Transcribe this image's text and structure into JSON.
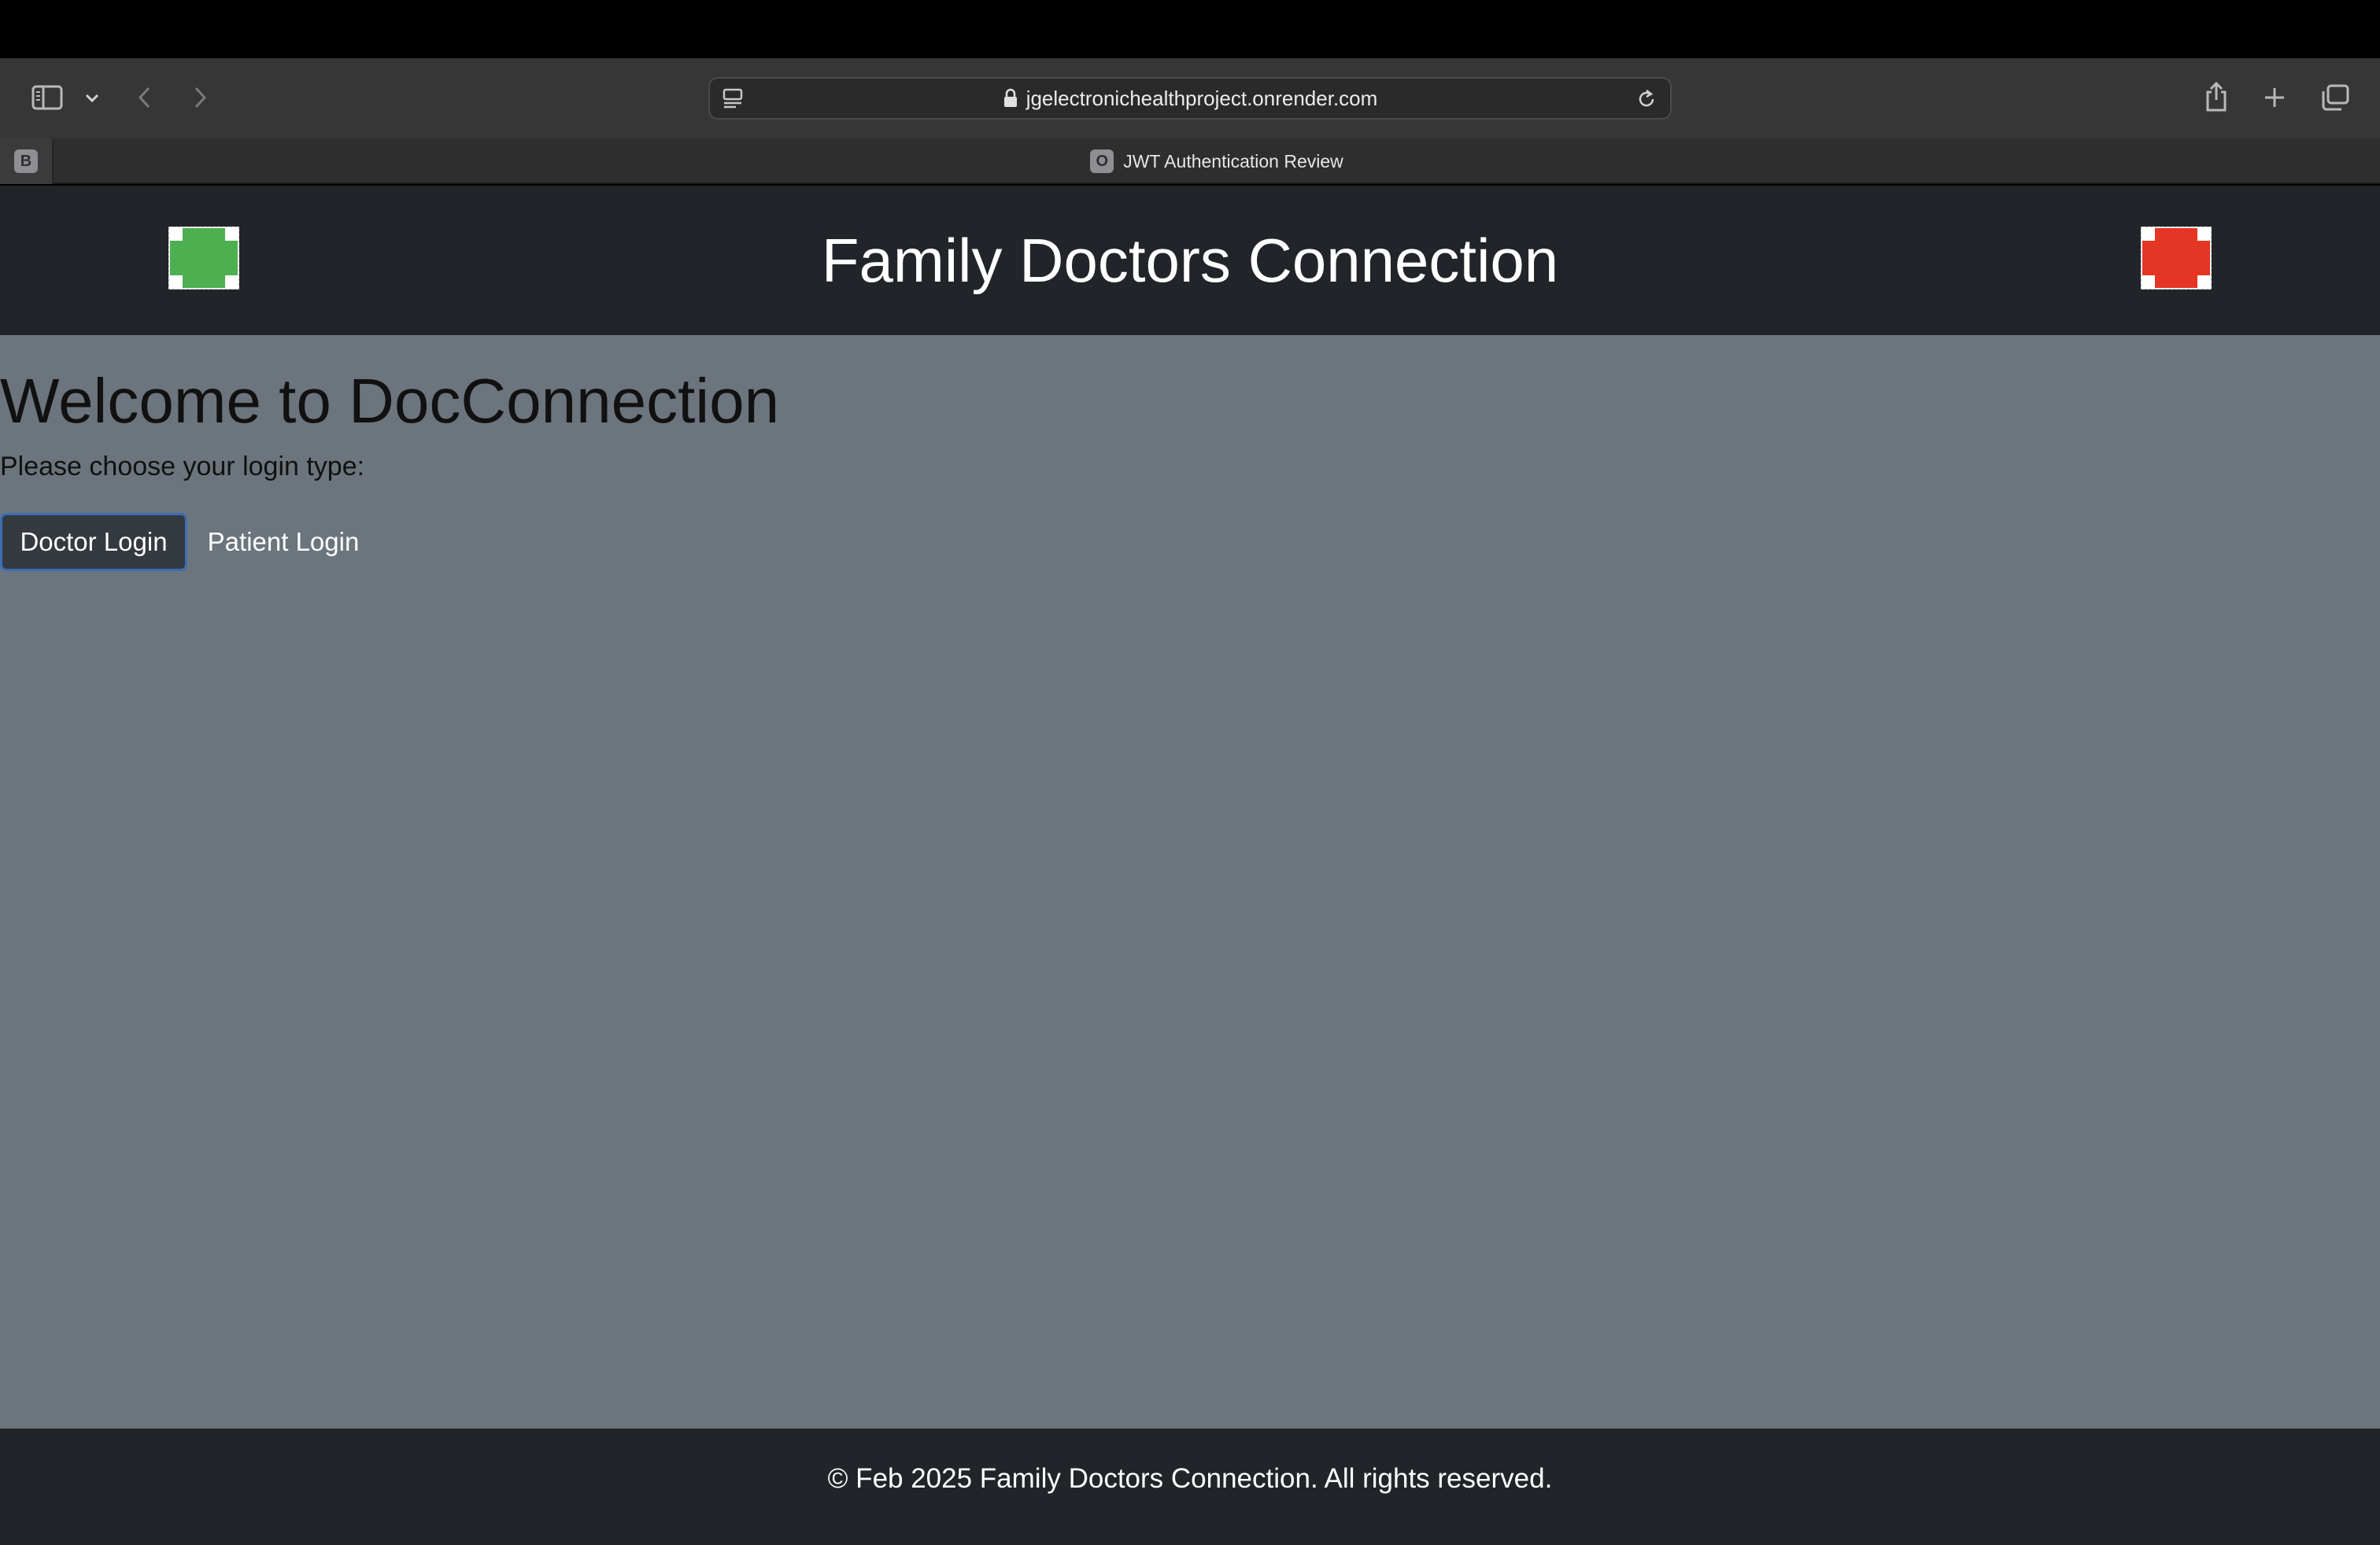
{
  "browser": {
    "url": "jgelectronichealthproject.onrender.com",
    "pinned_tab_letter": "B",
    "active_tab": {
      "favicon_letter": "O",
      "title": "JWT Authentication Review"
    },
    "icons": {
      "sidebar": "sidebar-icon",
      "dropdown": "chevron-down-icon",
      "back": "chevron-left-icon",
      "forward": "chevron-right-icon",
      "reader": "reader-icon",
      "lock": "lock-icon",
      "reload": "reload-icon",
      "share": "share-icon",
      "new_tab": "plus-icon",
      "tabs_overview": "tabs-overview-icon"
    }
  },
  "header": {
    "title": "Family Doctors Connection",
    "left_logo_color": "#4caf50",
    "right_logo_color": "#e53524"
  },
  "main": {
    "heading": "Welcome to DocConnection",
    "prompt": "Please choose your login type:",
    "doctor_button": "Doctor Login",
    "patient_button": "Patient Login"
  },
  "footer": {
    "text": "© Feb 2025 Family Doctors Connection. All rights reserved."
  },
  "colors": {
    "page_bg": "#6c757d",
    "header_bg": "#212529",
    "button_bg": "#343a40",
    "button_focus_border": "#3d6db4"
  }
}
